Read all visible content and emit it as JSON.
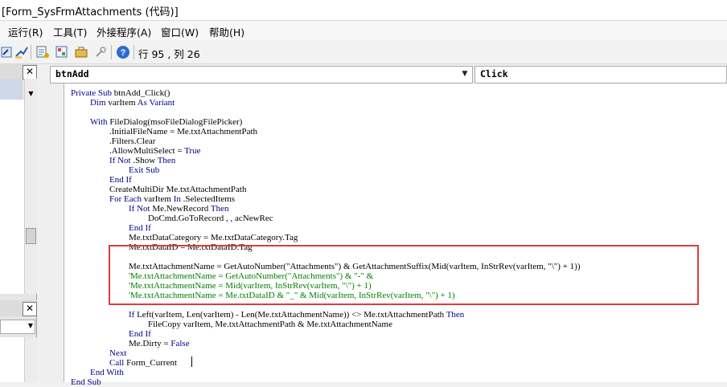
{
  "window": {
    "title": "[Form_SysFrmAttachments (代码)]"
  },
  "menu": {
    "items": [
      "运行(R)",
      "工具(T)",
      "外接程序(A)",
      "窗口(W)",
      "帮助(H)"
    ]
  },
  "toolbar": {
    "icons": [
      "design-mode-icon",
      "project-explorer-icon",
      "properties-icon",
      "object-browser-icon",
      "toolbox-icon",
      "help-icon"
    ],
    "position_readout": "行 95 , 列 26"
  },
  "left_pane": {
    "close_label": "✕"
  },
  "code_window": {
    "object_combo": "btnAdd",
    "procedure_combo": "Click",
    "lines": [
      {
        "indent": 0,
        "text": "Private Sub btnAdd_Click()",
        "comment": false
      },
      {
        "indent": 1,
        "text": "Dim varItem As Variant",
        "comment": false
      },
      {
        "indent": 0,
        "text": "",
        "comment": false
      },
      {
        "indent": 1,
        "text": "With FileDialog(msoFileDialogFilePicker)",
        "comment": false
      },
      {
        "indent": 2,
        "text": ".InitialFileName = Me.txtAttachmentPath",
        "comment": false
      },
      {
        "indent": 2,
        "text": ".Filters.Clear",
        "comment": false
      },
      {
        "indent": 2,
        "text": ".AllowMultiSelect = True",
        "comment": false
      },
      {
        "indent": 2,
        "text": "If Not .Show Then",
        "comment": false
      },
      {
        "indent": 3,
        "text": "Exit Sub",
        "comment": false
      },
      {
        "indent": 2,
        "text": "End If",
        "comment": false
      },
      {
        "indent": 2,
        "text": "CreateMultiDir Me.txtAttachmentPath",
        "comment": false
      },
      {
        "indent": 2,
        "text": "For Each varItem In .SelectedItems",
        "comment": false
      },
      {
        "indent": 3,
        "text": "If Not Me.NewRecord Then",
        "comment": false
      },
      {
        "indent": 4,
        "text": "DoCmd.GoToRecord , , acNewRec",
        "comment": false
      },
      {
        "indent": 3,
        "text": "End If",
        "comment": false
      },
      {
        "indent": 3,
        "text": "Me.txtDataCategory = Me.txtDataCategory.Tag",
        "comment": false
      },
      {
        "indent": 3,
        "text": "Me.txtDataID = Me.txtDataID.Tag",
        "comment": false
      },
      {
        "indent": 0,
        "text": "",
        "comment": false
      },
      {
        "indent": 3,
        "text": "Me.txtAttachmentName = GetAutoNumber(\"Attachments\") & GetAttachmentSuffix(Mid(varItem, InStrRev(varItem, \"\\\") + 1))",
        "comment": false
      },
      {
        "indent": 3,
        "text": "'Me.txtAttachmentName = GetAutoNumber(\"Attachments\") & \"-\" &",
        "comment": true
      },
      {
        "indent": 3,
        "text": "'Me.txtAttachmentName = Mid(varItem, InStrRev(varItem, \"\\\") + 1)",
        "comment": true
      },
      {
        "indent": 3,
        "text": "'Me.txtAttachmentName = Me.txtDataID & \"_\" & Mid(varItem, InStrRev(varItem, \"\\\") + 1)",
        "comment": true
      },
      {
        "indent": 0,
        "text": "",
        "comment": false
      },
      {
        "indent": 3,
        "text": "If Left(varItem, Len(varItem) - Len(Me.txtAttachmentName)) <> Me.txtAttachmentPath Then",
        "comment": false
      },
      {
        "indent": 4,
        "text": "FileCopy varItem, Me.txtAttachmentPath & Me.txtAttachmentName",
        "comment": false
      },
      {
        "indent": 3,
        "text": "End If",
        "comment": false
      },
      {
        "indent": 3,
        "text": "Me.Dirty = False",
        "comment": false
      },
      {
        "indent": 2,
        "text": "Next",
        "comment": false
      },
      {
        "indent": 2,
        "text": "Call Form_Current",
        "comment": false
      },
      {
        "indent": 1,
        "text": "End With",
        "comment": false
      },
      {
        "indent": 0,
        "text": "End Sub",
        "comment": false
      }
    ]
  },
  "colors": {
    "keyword": "#00008b",
    "comment": "#008000",
    "highlight": "#e03c3c"
  }
}
